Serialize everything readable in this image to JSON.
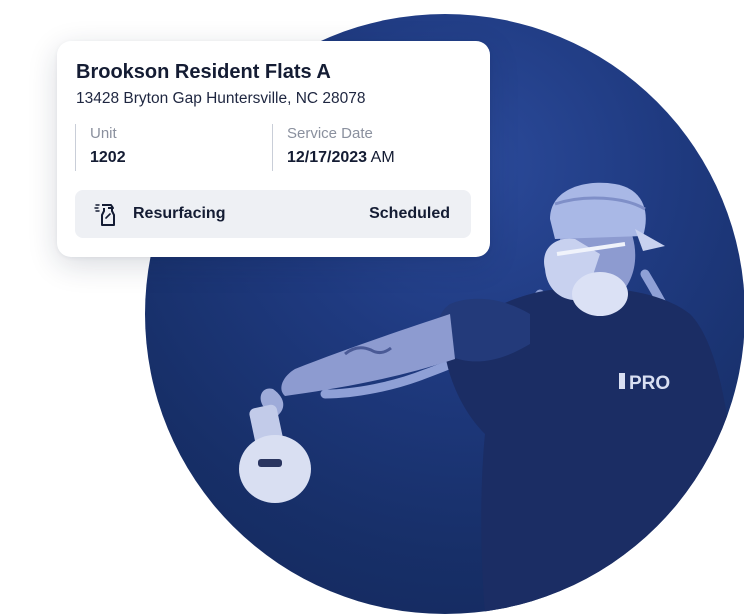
{
  "card": {
    "property_name": "Brookson Resident Flats A",
    "address": "13428 Bryton Gap Huntersville, NC 28078",
    "unit": {
      "label": "Unit",
      "value": "1202"
    },
    "service_date": {
      "label": "Service Date",
      "date": "12/17/2023",
      "period": "AM"
    },
    "service": {
      "icon": "spray-bottle-icon",
      "type": "Resurfacing",
      "status": "Scheduled"
    }
  },
  "hero": {
    "shirt_text": "PRO",
    "colors": {
      "circle": "#1f3a80",
      "circle_dark": "#13275a",
      "photo_tint": "#a9b8e6"
    }
  },
  "colors": {
    "text_primary": "#141c33",
    "text_muted": "#8a909e",
    "status_bg": "#eef0f4",
    "divider": "#c9ced8"
  }
}
